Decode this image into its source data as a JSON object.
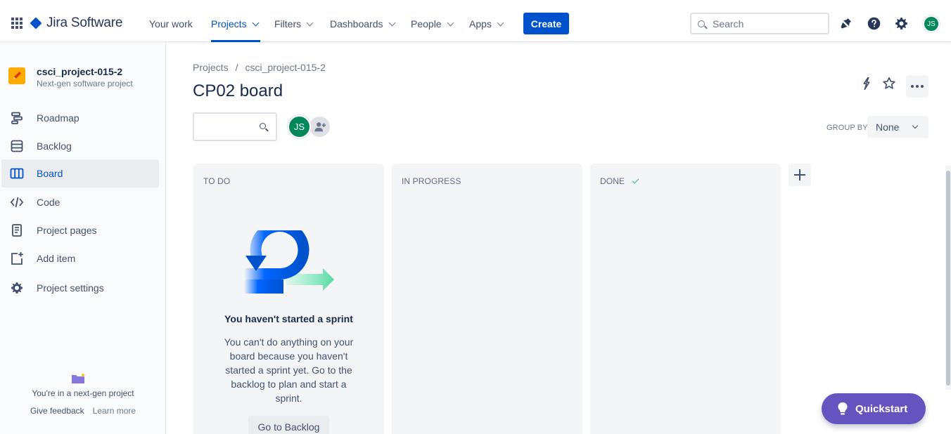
{
  "app": {
    "logo_text": "Jira Software",
    "colors": {
      "brand": "#0052cc",
      "quickstart": "#6554c0",
      "avatar": "#00875a",
      "project_avatar": "#ffab00"
    }
  },
  "topnav": {
    "items": [
      {
        "label": "Your work"
      },
      {
        "label": "Projects"
      },
      {
        "label": "Filters"
      },
      {
        "label": "Dashboards"
      },
      {
        "label": "People"
      },
      {
        "label": "Apps"
      }
    ],
    "active_item": "Projects",
    "create_label": "Create",
    "search_placeholder": "Search",
    "icons": [
      "notifications-icon",
      "help-icon",
      "settings-icon"
    ],
    "user_initials": "JS"
  },
  "sidebar": {
    "project_name": "csci_project-015-2",
    "project_type": "Next-gen software project",
    "items": [
      {
        "label": "Roadmap",
        "icon": "roadmap-icon"
      },
      {
        "label": "Backlog",
        "icon": "backlog-icon"
      },
      {
        "label": "Board",
        "icon": "board-icon",
        "active": true
      },
      {
        "label": "Code",
        "icon": "code-icon"
      },
      {
        "label": "Project pages",
        "icon": "pages-icon"
      },
      {
        "label": "Add item",
        "icon": "add-item-icon"
      },
      {
        "label": "Project settings",
        "icon": "gear-icon"
      }
    ],
    "footer_message": "You're in a next-gen project",
    "give_feedback": "Give feedback",
    "learn_more": "Learn more"
  },
  "main": {
    "breadcrumb": [
      "Projects",
      "/",
      "csci_project-015-2"
    ],
    "title": "CP02 board",
    "avatar_initials": "JS",
    "group_by_label": "GROUP BY",
    "group_by_value": "None",
    "columns": [
      {
        "title": "TO DO"
      },
      {
        "title": "IN PROGRESS"
      },
      {
        "title": "DONE"
      }
    ],
    "empty_state": {
      "title": "You haven't started a sprint",
      "body": "You can't do anything on your board because you haven't started a sprint yet. Go to the backlog to plan and start a sprint.",
      "button": "Go to Backlog"
    }
  },
  "quickstart_label": "Quickstart"
}
